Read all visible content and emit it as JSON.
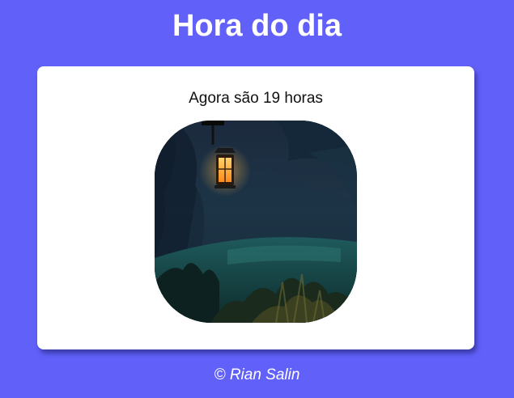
{
  "header": {
    "title": "Hora do dia"
  },
  "card": {
    "message": "Agora são 19 horas",
    "image_subject": "night-lantern-garden"
  },
  "footer": {
    "credit": "© Rian Salin"
  },
  "colors": {
    "background": "#6161f9",
    "card": "#ffffff",
    "text_light": "#ffffff",
    "text_dark": "#111111",
    "lantern_glow": "#ff9a1f"
  }
}
